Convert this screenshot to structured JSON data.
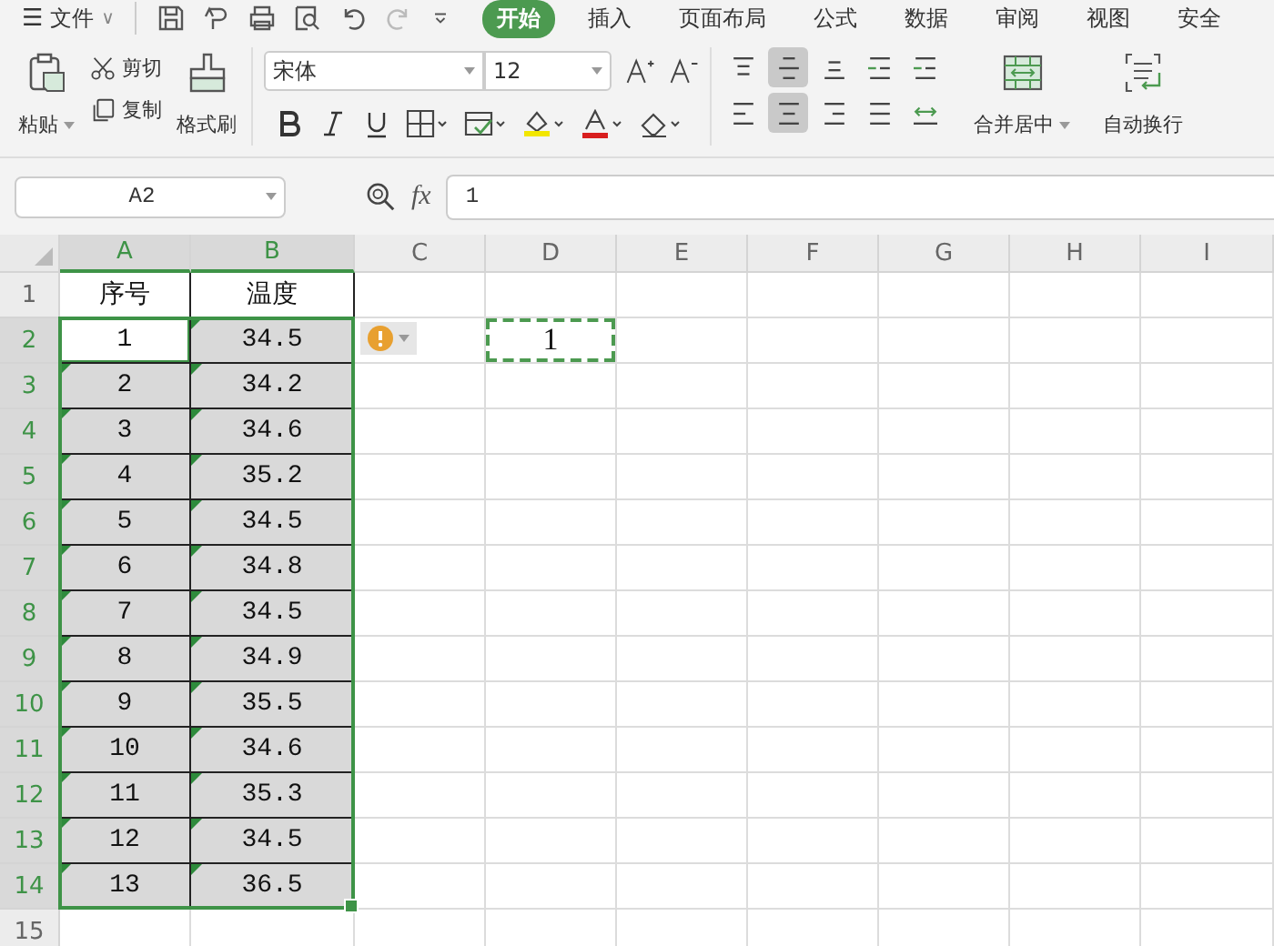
{
  "menu": {
    "file": {
      "icon": "☰",
      "label": "文件",
      "caret": "∨"
    },
    "tabs": [
      {
        "label": "开始",
        "selected": true
      },
      {
        "label": "插入",
        "selected": false
      },
      {
        "label": "页面布局",
        "selected": false
      },
      {
        "label": "公式",
        "selected": false
      },
      {
        "label": "数据",
        "selected": false
      },
      {
        "label": "审阅",
        "selected": false
      },
      {
        "label": "视图",
        "selected": false
      },
      {
        "label": "安全",
        "selected": false
      }
    ]
  },
  "ribbon": {
    "paste": "粘贴",
    "cut": "剪切",
    "copy": "复制",
    "format_painter": "格式刷",
    "font": "宋体",
    "font_size": "12",
    "alignment": [
      {
        "kind": "top",
        "selected": false
      },
      {
        "kind": "middle",
        "selected": true
      },
      {
        "kind": "bottom",
        "selected": false
      },
      {
        "kind": "outdent",
        "selected": false
      },
      {
        "kind": "indent",
        "selected": false
      },
      {
        "kind": "left",
        "selected": false
      },
      {
        "kind": "center",
        "selected": true
      },
      {
        "kind": "right",
        "selected": false
      },
      {
        "kind": "justify",
        "selected": false
      },
      {
        "kind": "distribute",
        "selected": false
      }
    ],
    "merge": "合并居中",
    "wrap": "自动换行"
  },
  "formula_bar": {
    "name_box": "A2",
    "fx": "fx",
    "value": "1"
  },
  "grid": {
    "columns": [
      {
        "label": "A",
        "selected": true
      },
      {
        "label": "B",
        "selected": true
      },
      {
        "label": "C",
        "selected": false
      },
      {
        "label": "D",
        "selected": false
      },
      {
        "label": "E",
        "selected": false
      },
      {
        "label": "F",
        "selected": false
      },
      {
        "label": "G",
        "selected": false
      },
      {
        "label": "H",
        "selected": false
      },
      {
        "label": "I",
        "selected": false
      }
    ],
    "rows": [
      {
        "label": "1",
        "selected": false,
        "cells": [
          {
            "text": "序号",
            "selected": false,
            "active": false,
            "marker": false
          },
          {
            "text": "温度",
            "selected": false,
            "active": false,
            "marker": false
          }
        ]
      },
      {
        "label": "2",
        "selected": true,
        "cells": [
          {
            "text": "1",
            "selected": true,
            "active": true,
            "marker": false
          },
          {
            "text": "34.5",
            "selected": true,
            "active": false,
            "marker": true
          }
        ],
        "extras": [
          {
            "kind": "warning"
          },
          {
            "kind": "copied",
            "text": "1"
          }
        ]
      },
      {
        "label": "3",
        "selected": true,
        "cells": [
          {
            "text": "2",
            "selected": true,
            "active": false,
            "marker": true
          },
          {
            "text": "34.2",
            "selected": true,
            "active": false,
            "marker": true
          }
        ]
      },
      {
        "label": "4",
        "selected": true,
        "cells": [
          {
            "text": "3",
            "selected": true,
            "active": false,
            "marker": true
          },
          {
            "text": "34.6",
            "selected": true,
            "active": false,
            "marker": true
          }
        ]
      },
      {
        "label": "5",
        "selected": true,
        "cells": [
          {
            "text": "4",
            "selected": true,
            "active": false,
            "marker": true
          },
          {
            "text": "35.2",
            "selected": true,
            "active": false,
            "marker": true
          }
        ]
      },
      {
        "label": "6",
        "selected": true,
        "cells": [
          {
            "text": "5",
            "selected": true,
            "active": false,
            "marker": true
          },
          {
            "text": "34.5",
            "selected": true,
            "active": false,
            "marker": true
          }
        ]
      },
      {
        "label": "7",
        "selected": true,
        "cells": [
          {
            "text": "6",
            "selected": true,
            "active": false,
            "marker": true
          },
          {
            "text": "34.8",
            "selected": true,
            "active": false,
            "marker": true
          }
        ]
      },
      {
        "label": "8",
        "selected": true,
        "cells": [
          {
            "text": "7",
            "selected": true,
            "active": false,
            "marker": true
          },
          {
            "text": "34.5",
            "selected": true,
            "active": false,
            "marker": true
          }
        ]
      },
      {
        "label": "9",
        "selected": true,
        "cells": [
          {
            "text": "8",
            "selected": true,
            "active": false,
            "marker": true
          },
          {
            "text": "34.9",
            "selected": true,
            "active": false,
            "marker": true
          }
        ]
      },
      {
        "label": "10",
        "selected": true,
        "cells": [
          {
            "text": "9",
            "selected": true,
            "active": false,
            "marker": true
          },
          {
            "text": "35.5",
            "selected": true,
            "active": false,
            "marker": true
          }
        ]
      },
      {
        "label": "11",
        "selected": true,
        "cells": [
          {
            "text": "10",
            "selected": true,
            "active": false,
            "marker": true
          },
          {
            "text": "34.6",
            "selected": true,
            "active": false,
            "marker": true
          }
        ]
      },
      {
        "label": "12",
        "selected": true,
        "cells": [
          {
            "text": "11",
            "selected": true,
            "active": false,
            "marker": true
          },
          {
            "text": "35.3",
            "selected": true,
            "active": false,
            "marker": true
          }
        ]
      },
      {
        "label": "13",
        "selected": true,
        "cells": [
          {
            "text": "12",
            "selected": true,
            "active": false,
            "marker": true
          },
          {
            "text": "34.5",
            "selected": true,
            "active": false,
            "marker": true
          }
        ]
      },
      {
        "label": "14",
        "selected": true,
        "cells": [
          {
            "text": "13",
            "selected": true,
            "active": false,
            "marker": true
          },
          {
            "text": "36.5",
            "selected": true,
            "active": false,
            "marker": true
          }
        ]
      },
      {
        "label": "15",
        "selected": false,
        "cells": []
      }
    ]
  }
}
